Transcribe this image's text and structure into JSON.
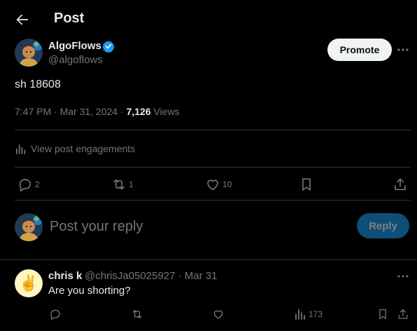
{
  "header": {
    "title": "Post"
  },
  "post": {
    "author_name": "AlgoFlows",
    "author_handle": "@algoflows",
    "promote_label": "Promote",
    "text": "sh 18608",
    "time": "7:47 PM · Mar 31, 2024 · ",
    "views_count": "7,126",
    "views_label": " Views",
    "engagements_label": "View post engagements",
    "actions": {
      "replies": "2",
      "reposts": "1",
      "likes": "10"
    }
  },
  "composer": {
    "placeholder": "Post your reply",
    "reply_label": "Reply"
  },
  "reply": {
    "author_name": "chris k",
    "meta": "@chrisJa05025927 · Mar 31",
    "text": "Are you shorting?",
    "avatar_glyph": "✌️",
    "views": "173"
  },
  "colors": {
    "accent": "#1d9bf0",
    "verified": "#1d9bf0",
    "muted": "#71767b",
    "divider": "#2f3336"
  }
}
